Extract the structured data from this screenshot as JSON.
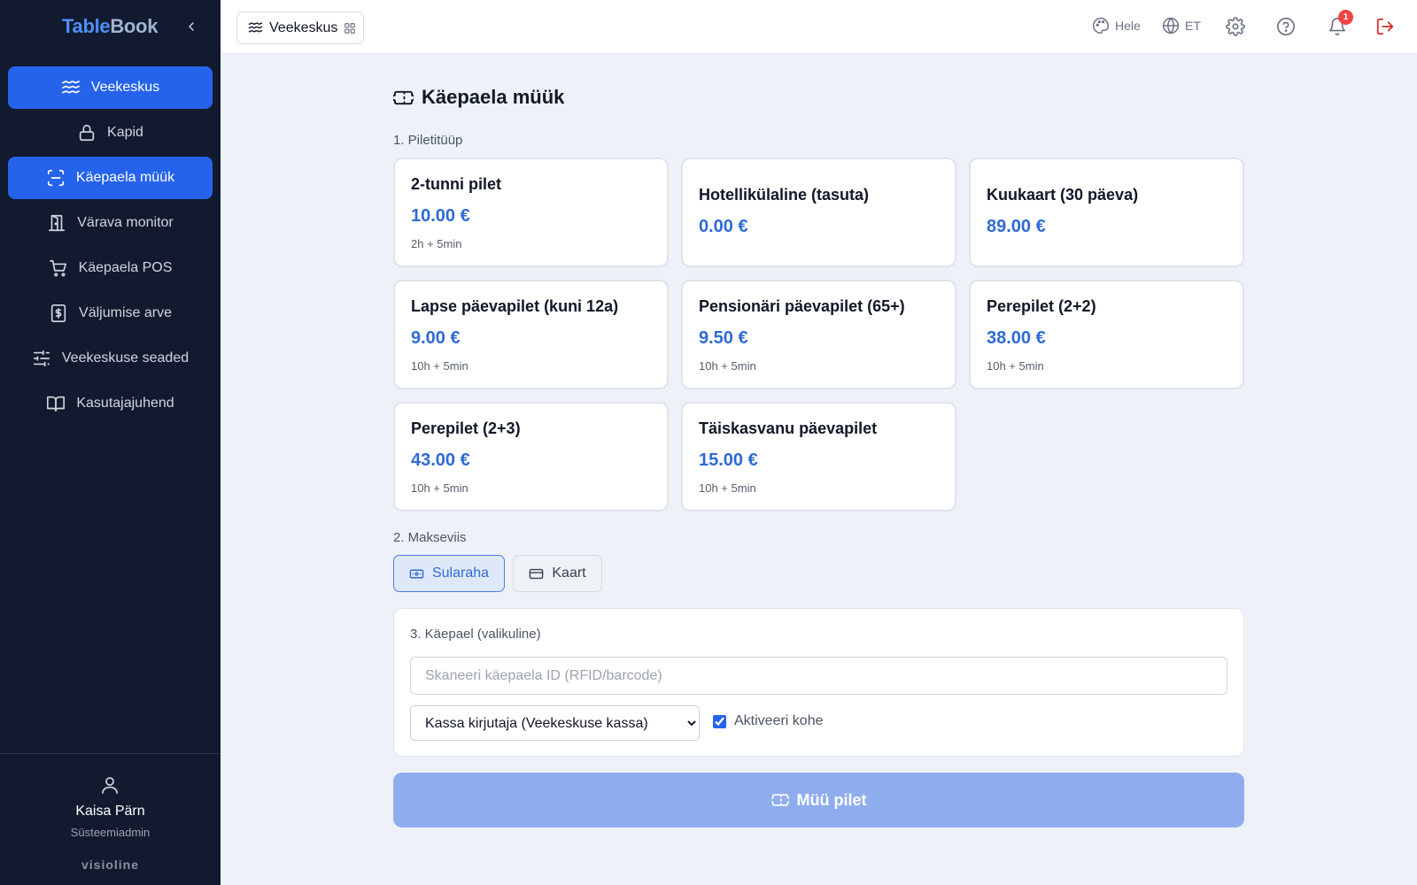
{
  "brand": {
    "part1": "Table",
    "part2": "Book"
  },
  "sidebar": {
    "items": [
      {
        "label": "Veekeskus",
        "icon": "waves-icon",
        "active": true
      },
      {
        "label": "Kapid",
        "icon": "lock-icon",
        "active": false
      },
      {
        "label": "Käepaela müük",
        "icon": "scan-icon",
        "active": true
      },
      {
        "label": "Värava monitor",
        "icon": "door-icon",
        "active": false
      },
      {
        "label": "Käepaela POS",
        "icon": "cart-icon",
        "active": false
      },
      {
        "label": "Väljumise arve",
        "icon": "receipt-icon",
        "active": false
      },
      {
        "label": "Veekeskuse seaded",
        "icon": "sliders-icon",
        "active": false
      },
      {
        "label": "Kasutajajuhend",
        "icon": "book-icon",
        "active": false
      }
    ]
  },
  "user": {
    "name": "Kaisa Pärn",
    "role": "Süsteemiadmin"
  },
  "footer_brand": "visioline",
  "header": {
    "module": "Veekeskus",
    "theme": "Hele",
    "language": "ET",
    "notifications": "1"
  },
  "main": {
    "title": "Käepaela müük",
    "step1": "1. Piletitüüp",
    "tickets": [
      {
        "name": "2-tunni pilet",
        "price": "10.00 €",
        "duration": "2h + 5min"
      },
      {
        "name": "Hotellikülaline (tasuta)",
        "price": "0.00 €",
        "duration": ""
      },
      {
        "name": "Kuukaart (30 päeva)",
        "price": "89.00 €",
        "duration": ""
      },
      {
        "name": "Lapse päevapilet (kuni 12a)",
        "price": "9.00 €",
        "duration": "10h + 5min"
      },
      {
        "name": "Pensionäri päevapilet (65+)",
        "price": "9.50 €",
        "duration": "10h + 5min"
      },
      {
        "name": "Perepilet (2+2)",
        "price": "38.00 €",
        "duration": "10h + 5min"
      },
      {
        "name": "Perepilet (2+3)",
        "price": "43.00 €",
        "duration": "10h + 5min"
      },
      {
        "name": "Täiskasvanu päevapilet",
        "price": "15.00 €",
        "duration": "10h + 5min"
      }
    ],
    "step2": "2. Makseviis",
    "payment": {
      "cash": "Sularaha",
      "card": "Kaart",
      "selected": "cash"
    },
    "step3": "3. Käepael (valikuline)",
    "wristband_placeholder": "Skaneeri käepaela ID (RFID/barcode)",
    "writer_selected": "Kassa kirjutaja (Veekeskuse kassa)",
    "activate_label": "Aktiveeri kohe",
    "activate_checked": true,
    "sell_button": "Müü pilet"
  },
  "colors": {
    "accent": "#2563eb",
    "price": "#2f6ad6",
    "sidebar_bg": "#111a2e",
    "danger": "#ef4444"
  }
}
